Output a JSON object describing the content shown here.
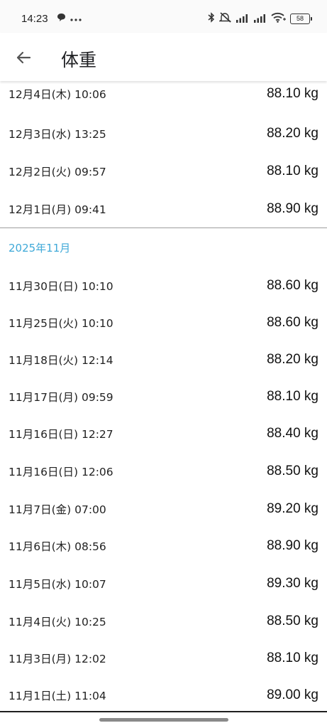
{
  "status_bar": {
    "time": "14:23",
    "left_icons": [
      "chat-bubble-icon",
      "more-dots-icon"
    ],
    "right_icons": [
      "bluetooth-icon",
      "mute-icon",
      "signal-icon",
      "signal-icon",
      "wifi-icon"
    ],
    "battery": "58"
  },
  "app_bar": {
    "title": "体重",
    "back_icon": "arrow-back-icon"
  },
  "list": {
    "top_rows": [
      {
        "date": "12月4日(木) 10:06",
        "weight": "88.10 kg"
      },
      {
        "date": "12月3日(水) 13:25",
        "weight": "88.20 kg"
      },
      {
        "date": "12月2日(火) 09:57",
        "weight": "88.10 kg"
      },
      {
        "date": "12月1日(月) 09:41",
        "weight": "88.90 kg"
      }
    ],
    "section_header": "2025年11月",
    "section_rows": [
      {
        "date": "11月30日(日) 10:10",
        "weight": "88.60 kg"
      },
      {
        "date": "11月25日(火) 10:10",
        "weight": "88.60 kg"
      },
      {
        "date": "11月18日(火) 12:14",
        "weight": "88.20 kg"
      },
      {
        "date": "11月17日(月) 09:59",
        "weight": "88.10 kg"
      },
      {
        "date": "11月16日(日) 12:27",
        "weight": "88.40 kg"
      },
      {
        "date": "11月16日(日) 12:06",
        "weight": "88.50 kg"
      },
      {
        "date": "11月7日(金) 07:00",
        "weight": "89.20 kg"
      },
      {
        "date": "11月6日(木) 08:56",
        "weight": "88.90 kg"
      },
      {
        "date": "11月5日(水) 10:07",
        "weight": "89.30 kg"
      },
      {
        "date": "11月4日(火) 10:25",
        "weight": "88.50 kg"
      },
      {
        "date": "11月3日(月) 12:02",
        "weight": "88.10 kg"
      },
      {
        "date": "11月1日(土) 11:04",
        "weight": "89.00 kg"
      }
    ]
  },
  "colors": {
    "section_header": "#3fa9d8",
    "divider": "#9e9e9e"
  }
}
